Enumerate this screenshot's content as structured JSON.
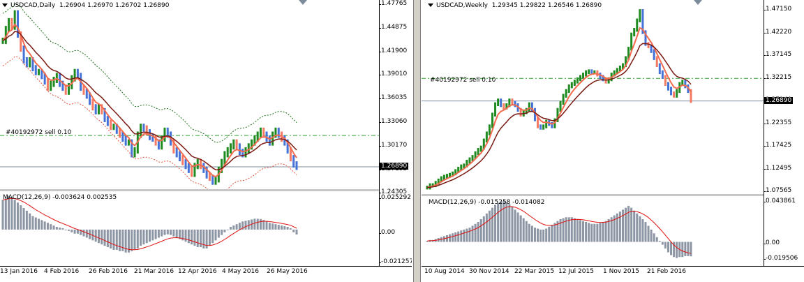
{
  "left": {
    "title": "USDCAD,Daily",
    "ohlc": "1.26904 1.26970 1.26702 1.26890",
    "price_ticks": [
      "1.47765",
      "1.44875",
      "1.41900",
      "1.39010",
      "1.36035",
      "1.33060",
      "1.30170",
      "1.27195",
      "1.24305"
    ],
    "current_price": "1.26890",
    "order_label": "#40192972 sell 0.10",
    "macd_label": "MACD(12,26,9) -0.003624 0.002535",
    "macd_ticks": [
      "0.025292",
      "0.00",
      "-0.021257"
    ],
    "dates": [
      "13 Jan 2016",
      "4 Feb 2016",
      "26 Feb 2016",
      "21 Mar 2016",
      "12 Apr 2016",
      "4 May 2016",
      "26 May 2016"
    ]
  },
  "right": {
    "title": "USDCAD,Weekly",
    "ohlc": "1.29345 1.29822 1.26546 1.26890",
    "price_ticks": [
      "1.47150",
      "1.42220",
      "1.37145",
      "1.32215",
      "1.27140",
      "1.22355",
      "1.17425",
      "1.12495",
      "1.07565"
    ],
    "current_price": "1.26890",
    "order_label": "#40192972 sell 0.10",
    "macd_label": "MACD(12,26,9) -0.015258 -0.014082",
    "macd_ticks": [
      "0.043861",
      "0.00",
      "-0.019506"
    ],
    "dates": [
      "10 Aug 2014",
      "30 Nov 2014",
      "22 Mar 2015",
      "12 Jul 2015",
      "1 Nov 2015",
      "21 Feb 2016"
    ]
  },
  "chart_data": [
    {
      "type": "bar",
      "title": "USDCAD,Daily",
      "ohlc": [
        1.26904,
        1.2697,
        1.26702,
        1.2689
      ],
      "ylim": [
        1.24305,
        1.47765
      ],
      "closes": [
        1.43,
        1.445,
        1.455,
        1.448,
        1.465,
        1.438,
        1.42,
        1.405,
        1.4,
        1.405,
        1.395,
        1.39,
        1.39,
        1.385,
        1.378,
        1.37,
        1.375,
        1.38,
        1.385,
        1.375,
        1.37,
        1.365,
        1.372,
        1.382,
        1.39,
        1.385,
        1.37,
        1.365,
        1.36,
        1.352,
        1.345,
        1.34,
        1.345,
        1.34,
        1.33,
        1.325,
        1.32,
        1.32,
        1.315,
        1.31,
        1.305,
        1.3,
        1.3,
        1.285,
        1.29,
        1.31,
        1.32,
        1.318,
        1.313,
        1.307,
        1.305,
        1.3,
        1.295,
        1.305,
        1.315,
        1.31,
        1.3,
        1.29,
        1.285,
        1.28,
        1.275,
        1.27,
        1.265,
        1.26,
        1.27,
        1.275,
        1.27,
        1.265,
        1.258,
        1.255,
        1.25,
        1.253,
        1.265,
        1.275,
        1.285,
        1.29,
        1.295,
        1.3,
        1.295,
        1.288,
        1.285,
        1.29,
        1.295,
        1.3,
        1.305,
        1.31,
        1.315,
        1.31,
        1.305,
        1.3,
        1.31,
        1.315,
        1.31,
        1.305,
        1.3,
        1.29,
        1.28,
        1.272,
        1.2689
      ],
      "macd": [
        0.022,
        0.024,
        0.025,
        0.024,
        0.022,
        0.02,
        0.018,
        0.016,
        0.014,
        0.012,
        0.01,
        0.009,
        0.008,
        0.007,
        0.006,
        0.005,
        0.004,
        0.003,
        0.002,
        0.0015,
        0.001,
        0,
        -0.001,
        -0.002,
        -0.003,
        -0.003,
        -0.004,
        -0.005,
        -0.006,
        -0.007,
        -0.008,
        -0.009,
        -0.01,
        -0.011,
        -0.012,
        -0.013,
        -0.014,
        -0.015,
        -0.015,
        -0.016,
        -0.016,
        -0.017,
        -0.017,
        -0.016,
        -0.015,
        -0.014,
        -0.012,
        -0.011,
        -0.01,
        -0.009,
        -0.008,
        -0.007,
        -0.006,
        -0.005,
        -0.004,
        -0.0035,
        -0.004,
        -0.005,
        -0.006,
        -0.007,
        -0.008,
        -0.009,
        -0.01,
        -0.011,
        -0.012,
        -0.013,
        -0.013,
        -0.014,
        -0.014,
        -0.012,
        -0.01,
        -0.008,
        -0.006,
        -0.004,
        -0.002,
        0,
        0.002,
        0.003,
        0.004,
        0.005,
        0.006,
        0.0065,
        0.007,
        0.0075,
        0.008,
        0.008,
        0.0078,
        0.0072,
        0.006,
        0.005,
        0.0045,
        0.004,
        0.0035,
        0.003,
        0.0025,
        0.002,
        0.001,
        -0.002,
        -0.003624
      ]
    },
    {
      "type": "bar",
      "title": "USDCAD,Weekly",
      "ohlc": [
        1.29345,
        1.29822,
        1.26546,
        1.2689
      ],
      "ylim": [
        1.07565,
        1.4715
      ],
      "closes": [
        1.085,
        1.09,
        1.09,
        1.095,
        1.1,
        1.105,
        1.108,
        1.11,
        1.112,
        1.115,
        1.12,
        1.125,
        1.13,
        1.132,
        1.14,
        1.145,
        1.15,
        1.158,
        1.165,
        1.17,
        1.185,
        1.2,
        1.215,
        1.24,
        1.262,
        1.27,
        1.26,
        1.255,
        1.26,
        1.27,
        1.265,
        1.26,
        1.25,
        1.24,
        1.245,
        1.25,
        1.262,
        1.25,
        1.23,
        1.215,
        1.212,
        1.215,
        1.225,
        1.22,
        1.215,
        1.228,
        1.25,
        1.265,
        1.28,
        1.29,
        1.3,
        1.305,
        1.31,
        1.315,
        1.32,
        1.325,
        1.33,
        1.332,
        1.33,
        1.33,
        1.325,
        1.32,
        1.315,
        1.31,
        1.315,
        1.325,
        1.33,
        1.335,
        1.34,
        1.345,
        1.36,
        1.38,
        1.41,
        1.42,
        1.44,
        1.46,
        1.415,
        1.39,
        1.385,
        1.375,
        1.36,
        1.345,
        1.33,
        1.32,
        1.305,
        1.295,
        1.285,
        1.28,
        1.29,
        1.305,
        1.31,
        1.3,
        1.29,
        1.2689
      ],
      "macd": [
        0.001,
        0.002,
        0.002,
        0.003,
        0.004,
        0.005,
        0.006,
        0.007,
        0.008,
        0.009,
        0.01,
        0.011,
        0.012,
        0.013,
        0.014,
        0.015,
        0.017,
        0.019,
        0.021,
        0.024,
        0.027,
        0.03,
        0.033,
        0.036,
        0.039,
        0.041,
        0.0425,
        0.043,
        0.042,
        0.04,
        0.037,
        0.034,
        0.031,
        0.028,
        0.025,
        0.022,
        0.019,
        0.017,
        0.015,
        0.014,
        0.013,
        0.013,
        0.014,
        0.016,
        0.018,
        0.02,
        0.022,
        0.024,
        0.025,
        0.026,
        0.026,
        0.026,
        0.025,
        0.024,
        0.023,
        0.022,
        0.021,
        0.02,
        0.019,
        0.019,
        0.019,
        0.02,
        0.021,
        0.022,
        0.024,
        0.026,
        0.028,
        0.03,
        0.032,
        0.034,
        0.036,
        0.038,
        0.036,
        0.033,
        0.03,
        0.027,
        0.024,
        0.021,
        0.017,
        0.013,
        0.009,
        0.005,
        0.001,
        -0.003,
        -0.007,
        -0.011,
        -0.014,
        -0.016,
        -0.017,
        -0.016,
        -0.016,
        -0.015,
        -0.015,
        -0.015258
      ]
    }
  ]
}
